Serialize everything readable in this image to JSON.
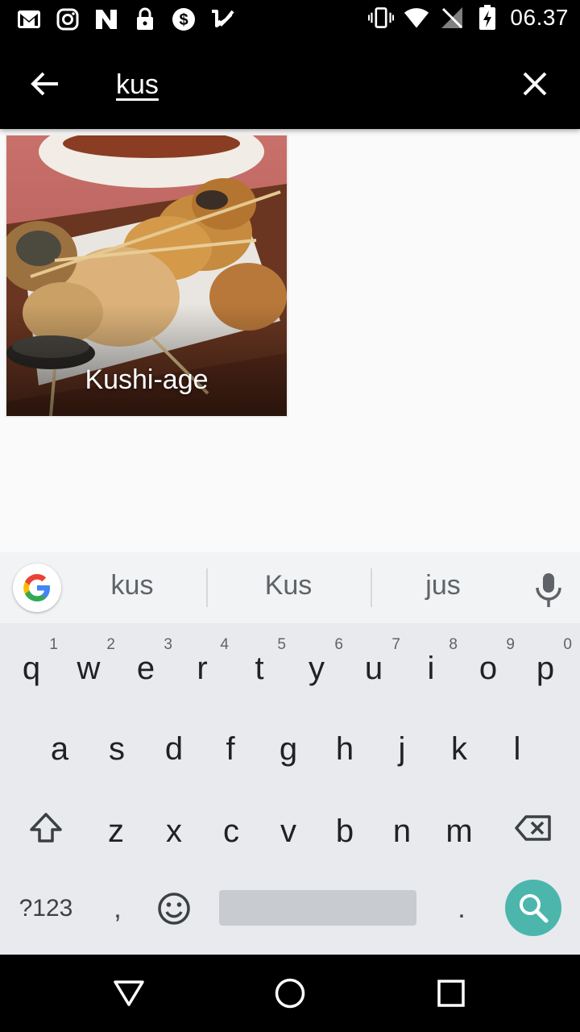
{
  "status_bar": {
    "time": "06.37",
    "left_icons": [
      "gmail-icon",
      "instagram-icon",
      "n-app-icon",
      "lock-icon",
      "dollar-icon",
      "tasks-check-icon"
    ],
    "right_icons": [
      "vibrate-icon",
      "wifi-icon",
      "no-signal-icon",
      "battery-charging-icon"
    ]
  },
  "toolbar": {
    "back_icon": "arrow-left-icon",
    "search_value": "kus",
    "clear_icon": "close-icon"
  },
  "results": [
    {
      "label": "Kushi-age"
    }
  ],
  "keyboard": {
    "suggestions": [
      "kus",
      "Kus",
      "jus"
    ],
    "row1": [
      {
        "key": "q",
        "hint": "1"
      },
      {
        "key": "w",
        "hint": "2"
      },
      {
        "key": "e",
        "hint": "3"
      },
      {
        "key": "r",
        "hint": "4"
      },
      {
        "key": "t",
        "hint": "5"
      },
      {
        "key": "y",
        "hint": "6"
      },
      {
        "key": "u",
        "hint": "7"
      },
      {
        "key": "i",
        "hint": "8"
      },
      {
        "key": "o",
        "hint": "9"
      },
      {
        "key": "p",
        "hint": "0"
      }
    ],
    "row2": [
      "a",
      "s",
      "d",
      "f",
      "g",
      "h",
      "j",
      "k",
      "l"
    ],
    "row3": [
      "z",
      "x",
      "c",
      "v",
      "b",
      "n",
      "m"
    ],
    "symbols_label": "?123",
    "comma_label": ",",
    "period_label": ".",
    "colors": {
      "search_key": "#4db6ac",
      "background": "#e8eaed"
    }
  },
  "navbar": {
    "icons": [
      "back-triangle-icon",
      "home-circle-icon",
      "recents-square-icon"
    ]
  }
}
